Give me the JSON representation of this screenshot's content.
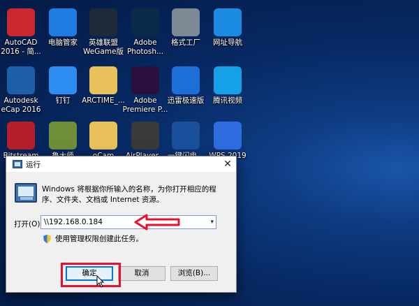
{
  "desktop": {
    "icons": [
      {
        "label": "AutoCAD",
        "label2": "2016 - 简...",
        "icon": "autocad-icon",
        "color": "#c8282e"
      },
      {
        "label": "电脑管家",
        "label2": "",
        "icon": "pc-manager-icon",
        "color": "#1f7ce0"
      },
      {
        "label": "英雄联盟",
        "label2": "WeGame版",
        "icon": "league-of-legends-icon",
        "color": "#1c2a3a"
      },
      {
        "label": "Adobe",
        "label2": "Photosh...",
        "icon": "photoshop-icon",
        "color": "#0b2a4a"
      },
      {
        "label": "格式工厂",
        "label2": "",
        "icon": "format-factory-icon",
        "color": "#7d8a96"
      },
      {
        "label": "网址导航",
        "label2": "",
        "icon": "ie-browser-icon",
        "color": "#1a8be0"
      },
      {
        "label": "Autodesk",
        "label2": "eCap 2016",
        "icon": "recap-icon",
        "color": "#1d5fa8"
      },
      {
        "label": "钉钉",
        "label2": "",
        "icon": "dingtalk-icon",
        "color": "#2e8df0"
      },
      {
        "label": "ARCTIME_...",
        "label2": "",
        "icon": "folder-icon",
        "color": "#e8c15a"
      },
      {
        "label": "Adobe",
        "label2": "Premiere P...",
        "icon": "premiere-icon",
        "color": "#2b0f3d"
      },
      {
        "label": "迅雷极速版",
        "label2": "",
        "icon": "xunlei-icon",
        "color": "#1b6fd6"
      },
      {
        "label": "腾讯视频",
        "label2": "",
        "icon": "tencent-video-icon",
        "color": "#16a0e8"
      },
      {
        "label": "Bitstream",
        "label2": "",
        "icon": "bitstream-icon",
        "color": "#b51f2c"
      },
      {
        "label": "鲁大师",
        "label2": "",
        "icon": "ludashi-icon",
        "color": "#6f8e3a"
      },
      {
        "label": "oCam",
        "label2": "",
        "icon": "folder-icon",
        "color": "#e8c15a"
      },
      {
        "label": "AirPlayer...",
        "label2": "",
        "icon": "airplayer-icon",
        "color": "#3a3a3a"
      },
      {
        "label": "一键闪电...",
        "label2": "",
        "icon": "lightning-icon",
        "color": "#1a4f9c"
      },
      {
        "label": "WPS 2019",
        "label2": "",
        "icon": "wps-icon",
        "color": "#2d6de0"
      }
    ]
  },
  "run_dialog": {
    "title": "运行",
    "description": "Windows 将根据你所输入的名称，为你打开相应的程序、文件夹、文档或 Internet 资源。",
    "open_label": "打开(O):",
    "open_value": "\\\\192.168.0.184",
    "admin_text": "使用管理权限创建此任务。",
    "ok_label": "确定",
    "cancel_label": "取消",
    "browse_label": "浏览(B)...",
    "close_glyph": "✕"
  },
  "annotation": {
    "highlight_color": "#e8112d"
  }
}
